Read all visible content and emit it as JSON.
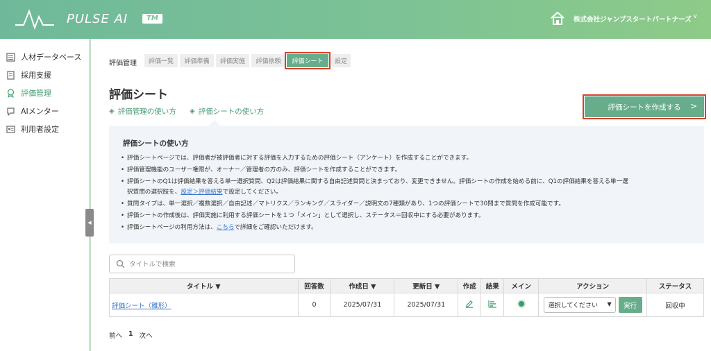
{
  "header": {
    "logo_text": "PULSE AI",
    "logo_tm": "TM",
    "company": "株式会社ジャンプスタートパートナーズ"
  },
  "sidebar": {
    "items": [
      {
        "label": "人材データベース",
        "icon": "database-icon"
      },
      {
        "label": "採用支援",
        "icon": "document-icon"
      },
      {
        "label": "評価管理",
        "icon": "badge-icon",
        "active": true
      },
      {
        "label": "AIメンター",
        "icon": "chat-icon"
      },
      {
        "label": "利用者設定",
        "icon": "user-card-icon"
      }
    ]
  },
  "breadcrumb": {
    "label": "評価管理",
    "tabs": [
      "評価一覧",
      "評価準備",
      "評価実施",
      "評価依頼",
      "評価シート",
      "設定"
    ],
    "active_tab": "評価シート"
  },
  "page": {
    "title": "評価シート",
    "links": [
      "評価管理の使い方",
      "評価シートの使い方"
    ],
    "create_button": "評価シートを作成する"
  },
  "info": {
    "title": "評価シートの使い方",
    "items": [
      "評価シートページでは、評価者が被評価者に対する評価を入力するための評価シート（アンケート）を作成することができます。",
      "評価管理機能のユーザー権限が、オーナー／管理者の方のみ、評価シートを作成することができます。",
      "評価シートのQ1は評価結果を答える単一選択質問、Q2は評価結果に関する自由記述質問と決まっており、変更できません。評価シートの作成を始める前に、Q1の評価結果を答える単一選",
      "択質問の選択肢を、",
      "設定＞評価結果",
      "で設定してください。",
      "質問タイプは、単一選択／複数選択／自由記述／マトリクス／ランキング／スライダー／説明文の7種類があり、1つの評価シートで30問まで質問を作成可能です。",
      "評価シートの作成後は、評価実施に利用する評価シートを１つ「メイン」として選択し、ステータス＝回収中にする必要があります。",
      "評価シートページの利用方法は、",
      "こちら",
      "で詳細をご確認いただけます。"
    ]
  },
  "search": {
    "placeholder": "タイトルで検索",
    "value": ""
  },
  "table": {
    "headers": [
      "タイトル ▼",
      "回答数",
      "作成日 ▼",
      "更新日 ▼",
      "作成",
      "結果",
      "メイン",
      "アクション",
      "ステータス"
    ],
    "rows": [
      {
        "title": "評価シート（雛形）",
        "answers": "0",
        "created": "2025/07/31",
        "updated": "2025/07/31",
        "select": "選択してください",
        "run": "実行",
        "status": "回収中"
      }
    ]
  },
  "pager": {
    "prev": "前へ",
    "current": "1",
    "next": "次へ"
  },
  "colors": {
    "accent": "#67ad8c",
    "highlight": "#d9402b",
    "link": "#3a74c8"
  }
}
